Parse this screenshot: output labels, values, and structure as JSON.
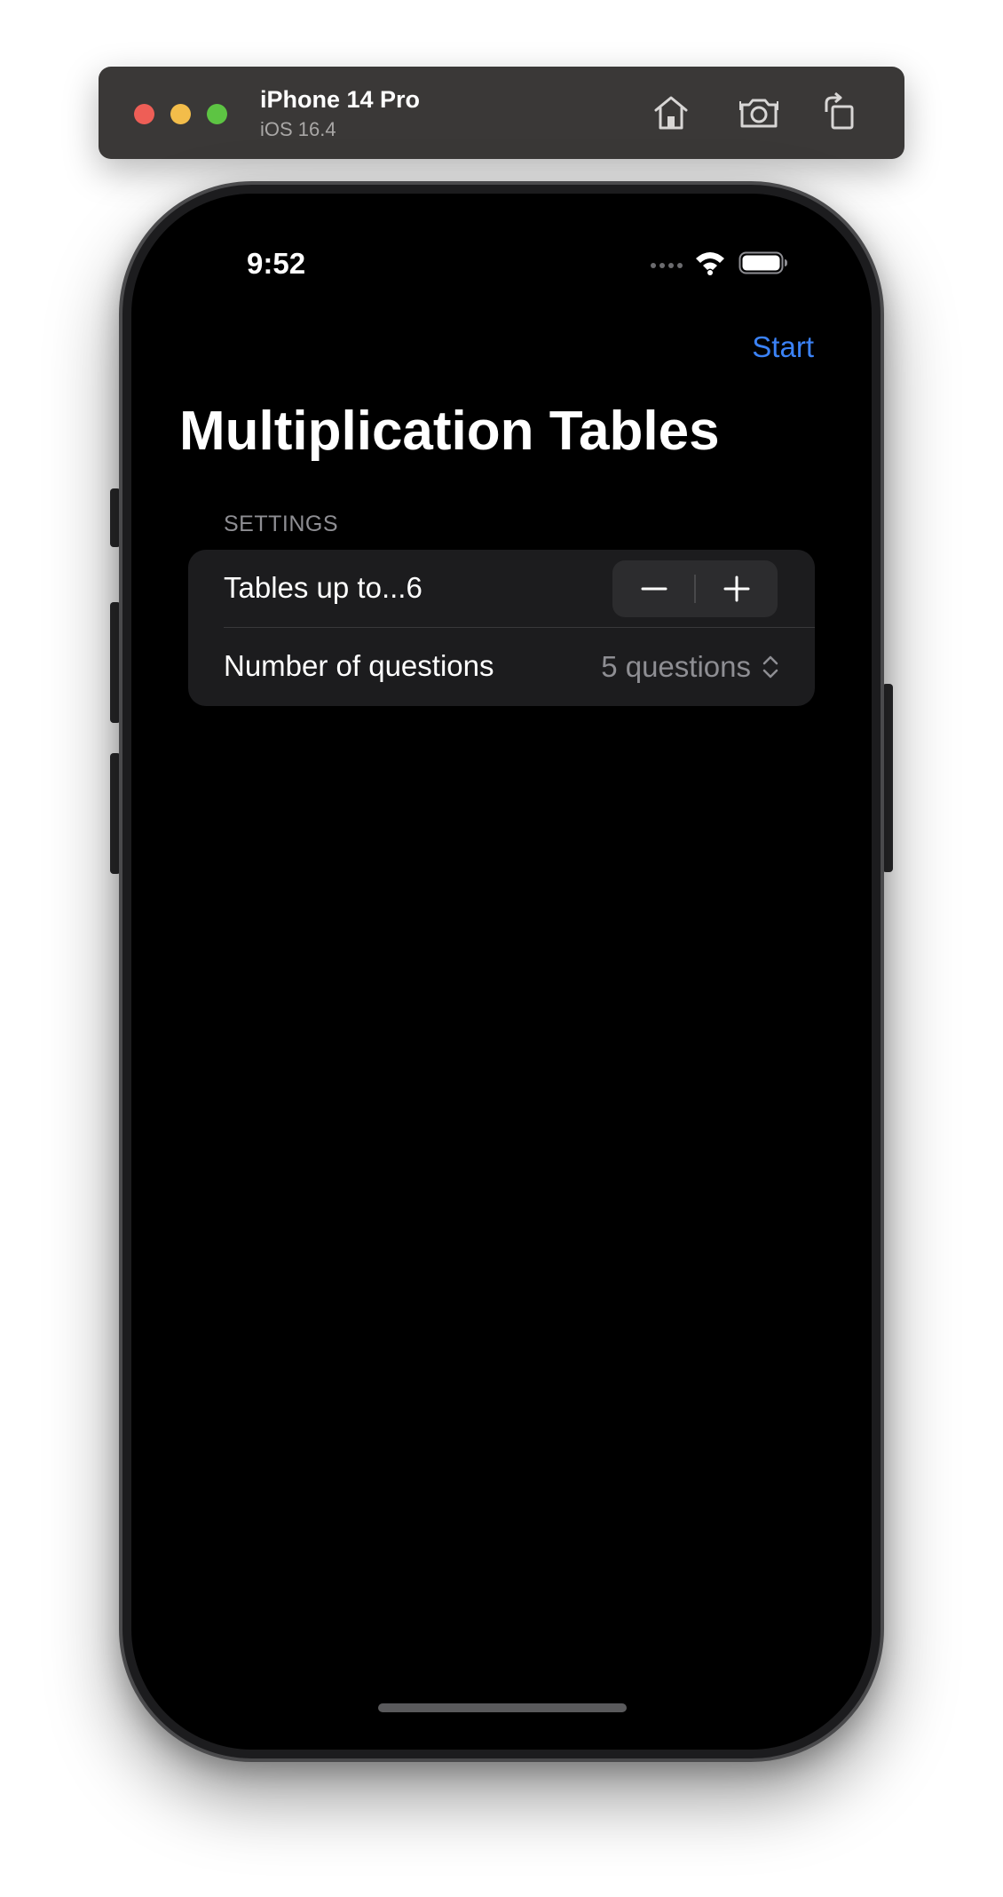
{
  "simulator": {
    "device_name": "iPhone 14 Pro",
    "os_version": "iOS 16.4"
  },
  "status_bar": {
    "time": "9:52"
  },
  "navigation": {
    "start_label": "Start",
    "title": "Multiplication Tables"
  },
  "settings": {
    "header": "SETTINGS",
    "tables_label": "Tables up to...6",
    "questions_label": "Number of questions",
    "questions_value": "5 questions"
  },
  "colors": {
    "accent": "#3b82f6",
    "background": "#000000",
    "card": "#1c1c1e",
    "secondary_text": "#8e8e93"
  },
  "icons": [
    "home-icon",
    "screenshot-icon",
    "rotate-icon",
    "signal-icon",
    "wifi-icon",
    "battery-icon",
    "minus-icon",
    "plus-icon",
    "chevron-updown-icon"
  ]
}
